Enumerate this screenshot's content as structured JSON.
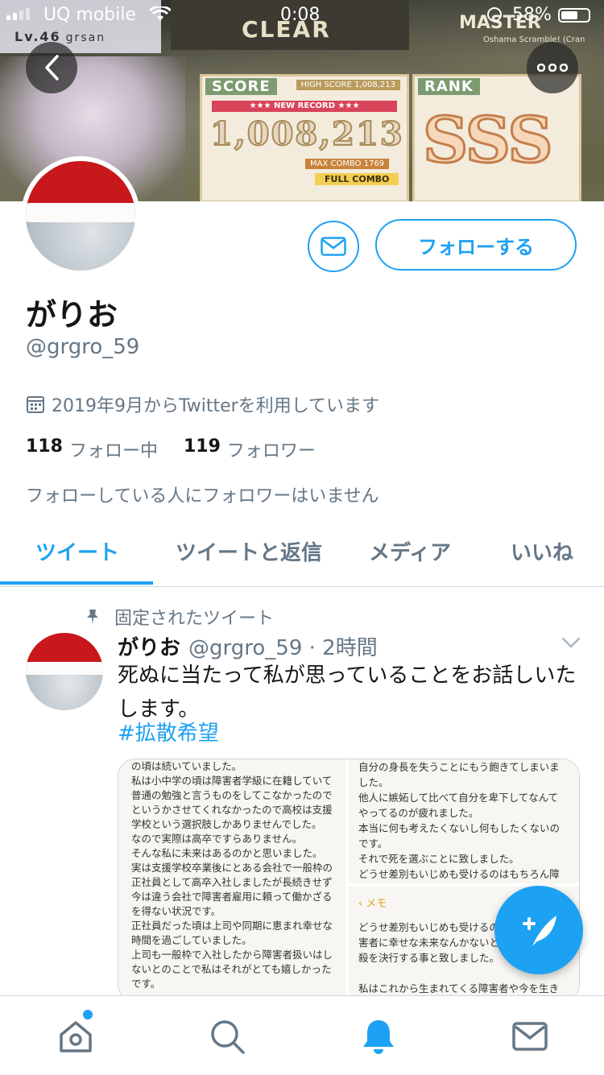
{
  "status_bar": {
    "carrier": "UQ mobile",
    "time": "0:08",
    "battery": "58%"
  },
  "banner": {
    "player_level": "46",
    "player_name": "grsan",
    "clear": "CLEAR",
    "score_label": "SCORE",
    "high_score_label": "HIGH SCORE 1,008,213",
    "new_record": "★★★ NEW RECORD ★★★",
    "score": "1,008,213",
    "max_combo": "MAX COMBO 1769",
    "full_combo": "FULL COMBO",
    "rank_label": "RANK",
    "rank": "SSS",
    "difficulty": "MASTER",
    "song": "Oshama Scramble! (Cran"
  },
  "profile": {
    "display_name": "がりお",
    "handle": "@grgro_59",
    "follow_button": "フォローする",
    "joined": "2019年9月からTwitterを利用しています",
    "following_count": "118",
    "following_label": "フォロー中",
    "followers_count": "119",
    "followers_label": "フォロワー",
    "followers_note": "フォローしている人にフォロワーはいません"
  },
  "tabs": [
    {
      "label": "ツイート"
    },
    {
      "label": "ツイートと返信"
    },
    {
      "label": "メディア"
    },
    {
      "label": "いいね"
    }
  ],
  "tweet": {
    "pinned_label": "固定されたツイート",
    "name": "がりお",
    "meta": "@grgro_59 · 2時間",
    "text": "死ぬに当たって私が思っていることをお話しいたします。",
    "hashtag": "#拡散希望",
    "media": {
      "left_lines": [
        "の頃は続いていました。",
        "私は小中学の頃は障害者学級に在籍していて",
        "普通の勉強と言うものをしてこなかったので",
        "というかさせてくれなかったので高校は支援",
        "学校という選択肢しかありませんでした。",
        "なので実際は高卒ですらありません。",
        "そんな私に未来はあるのかと思いました。",
        "実は支援学校卒業後にとある会社で一般枠の",
        "正社員として高卒入社しましたが長続きせず",
        "今は違う会社で障害者雇用に頼って働かざる",
        "を得ない状況です。",
        "正社員だった頃は上司や同期に恵まれ幸せな",
        "時間を過ごしていました。",
        "上司も一般枠で入社したから障害者扱いはし",
        "ないとのことで私はそれがとても嬉しかった",
        "です。"
      ],
      "right_top_lines": [
        "自分の身長を失うことにもう飽きてしまいました。",
        "他人に嫉妬して比べて自分を卑下してなんて",
        "やってるのが疲れました。",
        "本当に何も考えたくないし何もしたくないの",
        "です。",
        "それで死を選ぶことに致しました。",
        "どうせ差別もいじめも受けるのはもちろん障"
      ],
      "memo_back": "メモ",
      "right_bottom_lines": [
        "どうせ差別もいじめも受けるの",
        "害者に幸せな未来なんかないと",
        "殺を決行する事と致しました。",
        "",
        "私はこれから生まれてくる障害者や今を生き"
      ]
    }
  },
  "colors": {
    "accent": "#1da1f2",
    "text": "#14171a",
    "secondary": "#657786"
  }
}
